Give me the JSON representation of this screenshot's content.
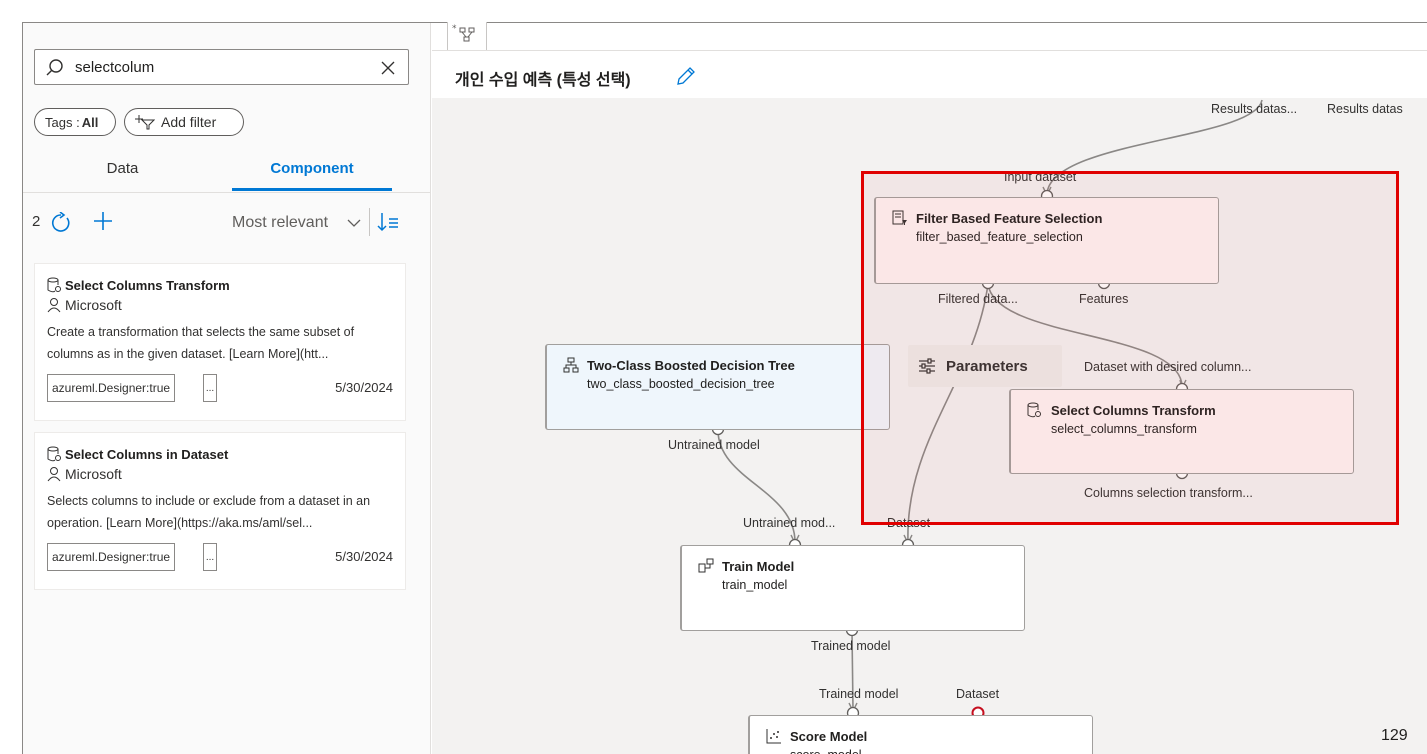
{
  "search": {
    "value": "selectcolum"
  },
  "filters": {
    "tags_label": "Tags : ",
    "tags_value": "All",
    "add_filter_label": "Add filter"
  },
  "tabs": [
    {
      "label": "Data"
    },
    {
      "label": "Component"
    }
  ],
  "results": {
    "count": "2",
    "sort_label": "Most relevant"
  },
  "cards": [
    {
      "title": "Select Columns Transform",
      "author": "Microsoft",
      "description": "Create a transformation that selects the same subset of columns as in the given dataset. [Learn More](htt...",
      "tag": "azureml.Designer:true",
      "more": "...",
      "date": "5/30/2024"
    },
    {
      "title": "Select Columns in Dataset",
      "author": "Microsoft",
      "description": "Selects columns to include or exclude from a dataset in an operation. [Learn More](https://aka.ms/aml/sel...",
      "tag": "azureml.Designer:true",
      "more": "...",
      "date": "5/30/2024"
    }
  ],
  "pipeline": {
    "title": "개인 수입 예측 (특성 선택)",
    "parameters_label": "Parameters",
    "nodes": {
      "filter": {
        "title": "Filter Based Feature Selection",
        "subtitle": "filter_based_feature_selection"
      },
      "boosted": {
        "title": "Two-Class Boosted Decision Tree",
        "subtitle": "two_class_boosted_decision_tree"
      },
      "select": {
        "title": "Select Columns Transform",
        "subtitle": "select_columns_transform"
      },
      "train": {
        "title": "Train Model",
        "subtitle": "train_model"
      },
      "score": {
        "title": "Score Model",
        "subtitle": "score_model"
      }
    },
    "ports": {
      "results_1": "Results datas...",
      "results_2": "Results datas",
      "input_dataset": "Input dataset",
      "filtered_data": "Filtered data...",
      "features": "Features",
      "dataset_with_desired": "Dataset with desired column...",
      "columns_selection": "Columns selection transform...",
      "untrained_model": "Untrained model",
      "untrained_mod": "Untrained mod...",
      "dataset_train": "Dataset",
      "trained_model_out": "Trained model",
      "trained_model_in": "Trained model",
      "dataset_score": "Dataset"
    }
  },
  "page_number": "129",
  "colors": {
    "accent": "#0078d4",
    "highlight": "#e00000",
    "error_port": "#c50f1f"
  }
}
